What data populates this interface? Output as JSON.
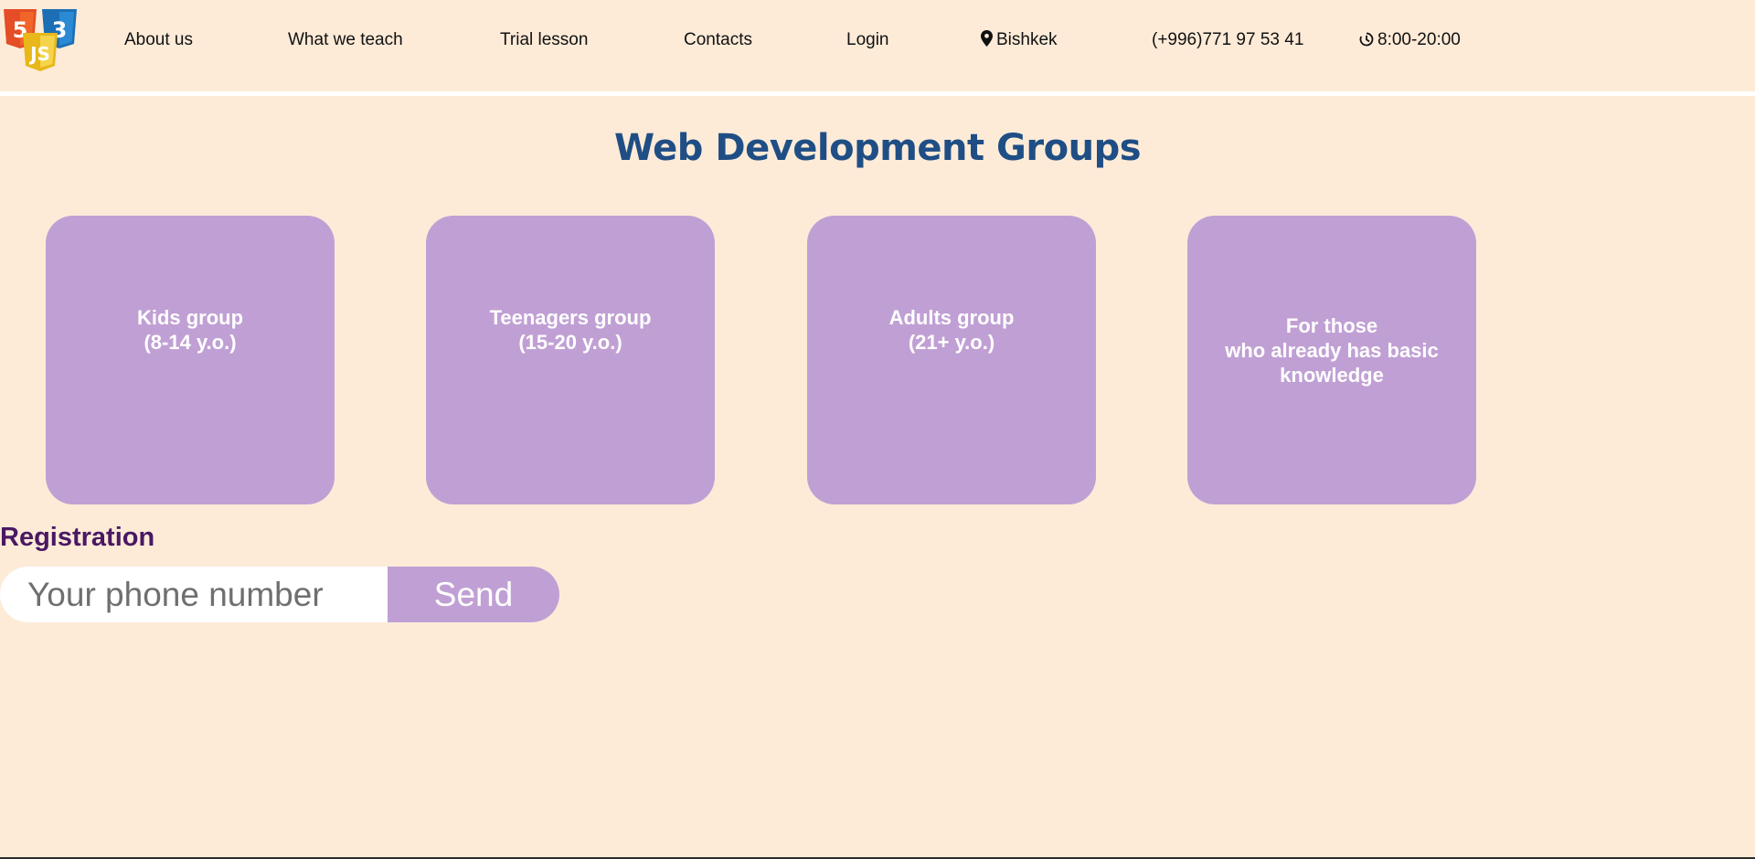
{
  "header": {
    "logo_html5_mark": "5",
    "logo_css3_mark": "3",
    "logo_js_mark": "JS",
    "nav": [
      "About us",
      "What we teach",
      "Trial lesson",
      "Contacts",
      "Login"
    ],
    "location_icon": "map-pin-icon",
    "location": "Bishkek",
    "phone": "(+996)771 97 53 41",
    "hours_icon": "clock-icon",
    "hours": "8:00-20:00"
  },
  "main": {
    "title": "Web Development Groups",
    "groups": [
      {
        "label": "Kids group\n(8-14 y.o.)"
      },
      {
        "label": "Teenagers group\n(15-20 y.o.)"
      },
      {
        "label": "Adults group\n(21+ y.o.)"
      },
      {
        "label": "For those\nwho already has basic\nknowledge"
      }
    ]
  },
  "registration": {
    "title": "Registration",
    "phone_placeholder": "Your phone number",
    "phone_value": "",
    "send_label": "Send"
  },
  "colors": {
    "page_background": "#fdebd8",
    "title": "#1f4e85",
    "card": "#c0a0d4",
    "registration_title": "#4a1863",
    "html5": "#e44d26",
    "css3": "#1d6fb5",
    "js": "#f0c420"
  }
}
